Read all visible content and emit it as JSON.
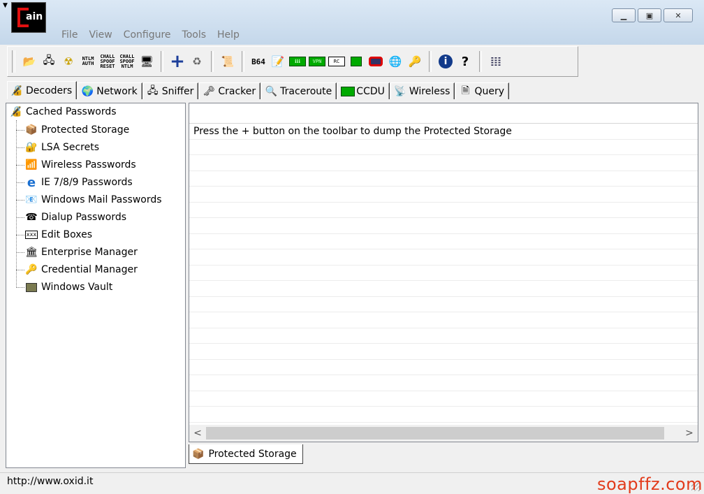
{
  "app": {
    "logo_text": "ain"
  },
  "menu": [
    "File",
    "View",
    "Configure",
    "Tools",
    "Help"
  ],
  "toolbar": {
    "ntlm_auth": "NTLM AUTH",
    "chall_spoof_reset": "CHALL SPOOF RESET",
    "chall_spoof_ntlm": "CHALL SPOOF NTLM",
    "b64": "B64",
    "chips": [
      "ℹℹℹ",
      "VPN",
      "RC"
    ]
  },
  "tabs": [
    {
      "label": "Decoders",
      "icon": "decoders-icon"
    },
    {
      "label": "Network",
      "icon": "network-icon"
    },
    {
      "label": "Sniffer",
      "icon": "sniffer-icon"
    },
    {
      "label": "Cracker",
      "icon": "cracker-icon"
    },
    {
      "label": "Traceroute",
      "icon": "traceroute-icon"
    },
    {
      "label": "CCDU",
      "icon": "ccdu-icon"
    },
    {
      "label": "Wireless",
      "icon": "wireless-icon"
    },
    {
      "label": "Query",
      "icon": "query-icon"
    }
  ],
  "tree": {
    "root": "Cached Passwords",
    "items": [
      "Protected Storage",
      "LSA Secrets",
      "Wireless Passwords",
      "IE 7/8/9 Passwords",
      "Windows Mail Passwords",
      "Dialup Passwords",
      "Edit Boxes",
      "Enterprise Manager",
      "Credential Manager",
      "Windows Vault"
    ],
    "edit_box_icon_text": "xxx"
  },
  "list": {
    "message": "Press the + button on the toolbar to dump the Protected Storage"
  },
  "bottom_tab": "Protected Storage",
  "status": {
    "text": "http://www.oxid.it"
  },
  "watermark": "soapffz.com",
  "colors": {
    "accent_red": "#e01010",
    "watermark": "#e23b1b",
    "plus_blue": "#1d3f9a"
  }
}
